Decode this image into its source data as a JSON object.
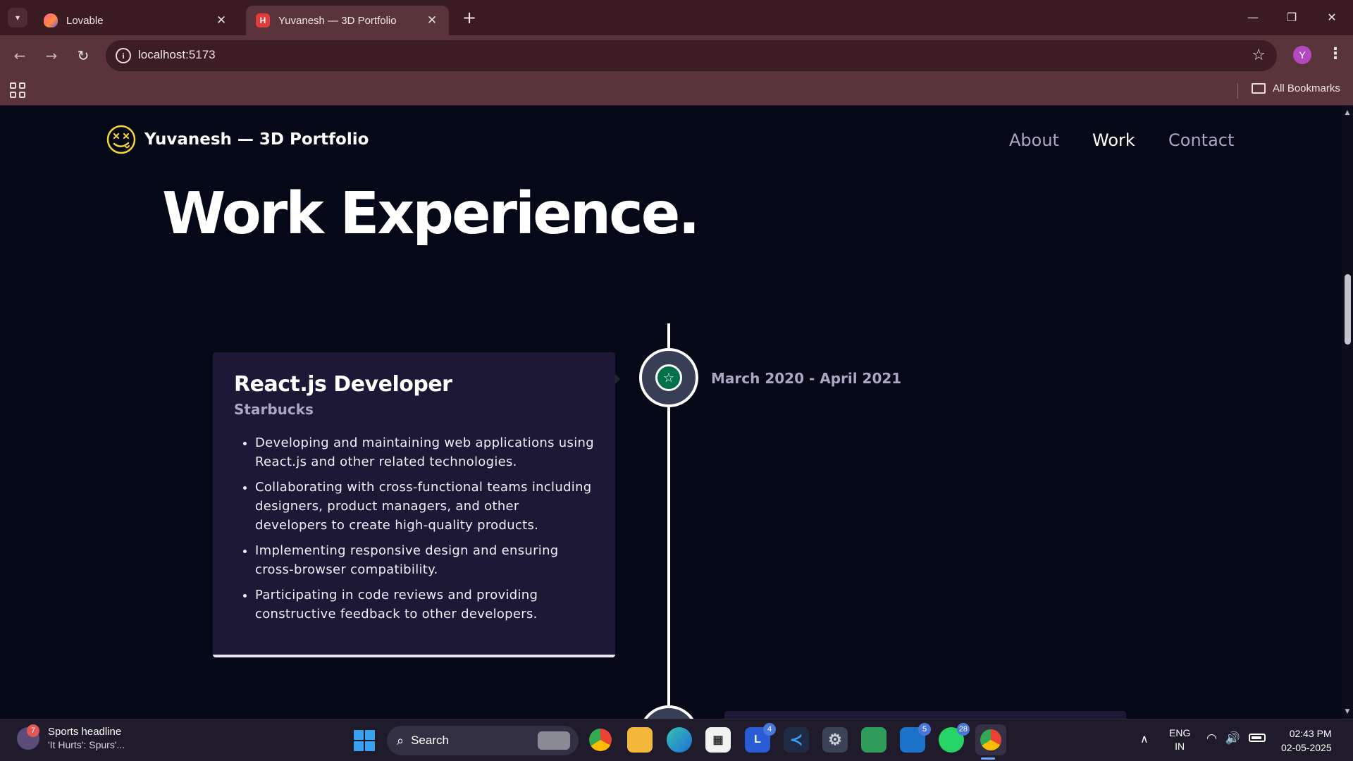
{
  "browser": {
    "tabs": [
      {
        "title": "Lovable",
        "favicon": "lovable-heart-icon",
        "active": false
      },
      {
        "title": "Yuvanesh — 3D Portfolio",
        "favicon": "h-square-icon",
        "active": true
      }
    ],
    "url": "localhost:5173",
    "profile_initial": "Y",
    "bookmarks_folder": "All Bookmarks"
  },
  "site": {
    "title": "Yuvanesh — 3D Portfolio",
    "logo_icon": "smiley-face-icon",
    "nav": [
      {
        "label": "About",
        "active": false
      },
      {
        "label": "Work",
        "active": true
      },
      {
        "label": "Contact",
        "active": false
      }
    ]
  },
  "section": {
    "heading": "Work Experience."
  },
  "experience": [
    {
      "title": "React.js Developer",
      "company": "Starbucks",
      "company_icon": "starbucks-logo-icon",
      "date": "March 2020 - April 2021",
      "points": [
        "Developing and maintaining web applications using React.js and other related technologies.",
        "Collaborating with cross-functional teams including designers, product managers, and other developers to create high-quality products.",
        "Implementing responsive design and ensuring cross-browser compatibility.",
        "Participating in code reviews and providing constructive feedback to other developers."
      ]
    }
  ],
  "taskbar": {
    "news_badge": "7",
    "news_title": "Sports headline",
    "news_subtitle": "'It Hurts': Spurs'...",
    "search_placeholder": "Search",
    "badges": {
      "lovable": "4",
      "outlook": "5",
      "whatsapp": "28"
    },
    "lang_top": "ENG",
    "lang_bottom": "IN",
    "time": "02:43 PM",
    "date": "02-05-2025"
  },
  "colors": {
    "background": "#050816",
    "card": "#1d1836",
    "secondary_text": "#aaa6c3",
    "browser_frame": "#3a1b21"
  }
}
